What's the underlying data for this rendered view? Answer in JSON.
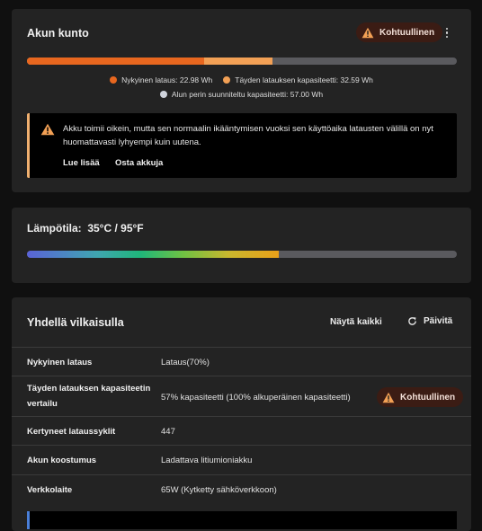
{
  "battery_health": {
    "title": "Akun kunto",
    "badge": "Kohtuullinen",
    "more_icon": "more-vertical-icon",
    "bar": {
      "current_pct": 41.2,
      "full_pct": 57.2,
      "design_pct": 100
    },
    "legend": [
      {
        "label": "Nykyinen lataus:",
        "value": "22.98 Wh",
        "color": "#e8671f"
      },
      {
        "label": "Täyden latauksen kapasiteetti:",
        "value": "32.59 Wh",
        "color": "#f2a055"
      },
      {
        "label": "Alun perin suunniteltu kapasiteetti:",
        "value": "57.00 Wh",
        "color": "#cfd3dc"
      }
    ],
    "alert": {
      "icon": "warning-icon",
      "text": "Akku toimii oikein, mutta sen normaalin ikääntymisen vuoksi sen käyttöaika latausten välillä on nyt huomattavasti lyhyempi kuin uutena.",
      "link_more": "Lue lisää",
      "link_buy": "Osta akkuja"
    }
  },
  "temperature": {
    "title": "Lämpötila:  35°C / 95°F",
    "fill_pct": 58.5
  },
  "overview": {
    "title": "Yhdellä vilkaisulla",
    "show_all": "Näytä kaikki",
    "refresh": "Päivitä",
    "refresh_icon": "refresh-icon",
    "rows": [
      {
        "label": "Nykyinen lataus",
        "value": "Lataus(70%)"
      },
      {
        "label": "Täyden latauksen kapasiteetin vertailu",
        "value": "57% kapasiteetti (100% alkuperäinen kapasiteetti)",
        "badge": "Kohtuullinen"
      },
      {
        "label": "Kertyneet lataussyklit",
        "value": "447"
      },
      {
        "label": "Akun koostumus",
        "value": "Ladattava litiumioniakku"
      },
      {
        "label": "Verkkolaite",
        "value": "65W (Kytketty sähköverkkoon)"
      }
    ]
  },
  "colors": {
    "current": "#e8671f",
    "full": "#f2a055",
    "design": "#5a5a5e",
    "warning_bg": "#f2a055",
    "card": "#232323"
  }
}
